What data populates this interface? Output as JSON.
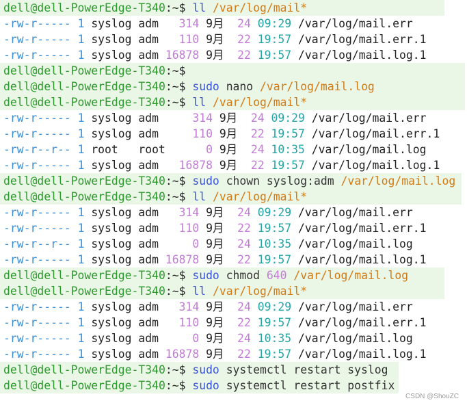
{
  "prompt": "dell@dell-PowerEdge-T340",
  "cwd": ":~$",
  "blocks": [
    {
      "type": "cmd",
      "w": "w650",
      "cmd": "ll",
      "args": "",
      "path": "/var/log/mail*"
    },
    {
      "type": "ls",
      "rows": [
        {
          "perm": "-rw-r-----",
          "links": "1",
          "owner": "syslog",
          "group": "adm",
          "size": "  314",
          "month": "9月",
          "day": "24",
          "time": "09:29",
          "file": "/var/log/mail.err"
        },
        {
          "perm": "-rw-r-----",
          "links": "1",
          "owner": "syslog",
          "group": "adm",
          "size": "  110",
          "month": "9月",
          "day": "22",
          "time": "19:57",
          "file": "/var/log/mail.err.1"
        },
        {
          "perm": "-rw-r-----",
          "links": "1",
          "owner": "syslog",
          "group": "adm",
          "size": "16878",
          "month": "9月",
          "day": "22",
          "time": "19:57",
          "file": "/var/log/mail.log.1"
        }
      ]
    },
    {
      "type": "cmd",
      "w": "w680",
      "cmd": "",
      "args": "",
      "path": ""
    },
    {
      "type": "cmd",
      "w": "w680",
      "cmd": "sudo",
      "args": "nano",
      "path": "/var/log/mail.log"
    },
    {
      "type": "cmd",
      "w": "w680",
      "cmd": "ll",
      "args": "",
      "path": "/var/log/mail*"
    },
    {
      "type": "ls",
      "rows": [
        {
          "perm": "-rw-r-----",
          "links": "1",
          "owner": "syslog",
          "group": "adm  ",
          "size": "  314",
          "month": "9月",
          "day": "24",
          "time": "09:29",
          "file": "/var/log/mail.err"
        },
        {
          "perm": "-rw-r-----",
          "links": "1",
          "owner": "syslog",
          "group": "adm  ",
          "size": "  110",
          "month": "9月",
          "day": "22",
          "time": "19:57",
          "file": "/var/log/mail.err.1"
        },
        {
          "perm": "-rw-r--r--",
          "links": "1",
          "owner": "root  ",
          "group": "root ",
          "size": "    0",
          "month": "9月",
          "day": "24",
          "time": "10:35",
          "file": "/var/log/mail.log"
        },
        {
          "perm": "-rw-r-----",
          "links": "1",
          "owner": "syslog",
          "group": "adm  ",
          "size": "16878",
          "month": "9月",
          "day": "22",
          "time": "19:57",
          "file": "/var/log/mail.log.1"
        }
      ]
    },
    {
      "type": "cmd",
      "w": "w675",
      "cmd": "sudo",
      "args": "chown syslog:adm",
      "path": "/var/log/mail.log"
    },
    {
      "type": "cmd",
      "w": "w675",
      "cmd": "ll",
      "args": "",
      "path": "/var/log/mail*"
    },
    {
      "type": "ls",
      "rows": [
        {
          "perm": "-rw-r-----",
          "links": "1",
          "owner": "syslog",
          "group": "adm",
          "size": "  314",
          "month": "9月",
          "day": "24",
          "time": "09:29",
          "file": "/var/log/mail.err"
        },
        {
          "perm": "-rw-r-----",
          "links": "1",
          "owner": "syslog",
          "group": "adm",
          "size": "  110",
          "month": "9月",
          "day": "22",
          "time": "19:57",
          "file": "/var/log/mail.err.1"
        },
        {
          "perm": "-rw-r--r--",
          "links": "1",
          "owner": "syslog",
          "group": "adm",
          "size": "    0",
          "month": "9月",
          "day": "24",
          "time": "10:35",
          "file": "/var/log/mail.log"
        },
        {
          "perm": "-rw-r-----",
          "links": "1",
          "owner": "syslog",
          "group": "adm",
          "size": "16878",
          "month": "9月",
          "day": "22",
          "time": "19:57",
          "file": "/var/log/mail.log.1"
        }
      ]
    },
    {
      "type": "cmd",
      "w": "w650",
      "cmd": "sudo",
      "args": "chmod",
      "num": "640",
      "path": "/var/log/mail.log"
    },
    {
      "type": "cmd",
      "w": "w650",
      "cmd": "ll",
      "args": "",
      "path": "/var/log/mail*"
    },
    {
      "type": "ls",
      "rows": [
        {
          "perm": "-rw-r-----",
          "links": "1",
          "owner": "syslog",
          "group": "adm",
          "size": "  314",
          "month": "9月",
          "day": "24",
          "time": "09:29",
          "file": "/var/log/mail.err"
        },
        {
          "perm": "-rw-r-----",
          "links": "1",
          "owner": "syslog",
          "group": "adm",
          "size": "  110",
          "month": "9月",
          "day": "22",
          "time": "19:57",
          "file": "/var/log/mail.err.1"
        },
        {
          "perm": "-rw-r-----",
          "links": "1",
          "owner": "syslog",
          "group": "adm",
          "size": "    0",
          "month": "9月",
          "day": "24",
          "time": "10:35",
          "file": "/var/log/mail.log"
        },
        {
          "perm": "-rw-r-----",
          "links": "1",
          "owner": "syslog",
          "group": "adm",
          "size": "16878",
          "month": "9月",
          "day": "22",
          "time": "19:57",
          "file": "/var/log/mail.log.1"
        }
      ]
    },
    {
      "type": "cmd",
      "w": "w583",
      "cmd": "sudo",
      "args": "systemctl restart syslog",
      "path": ""
    },
    {
      "type": "cmd",
      "w": "w583",
      "cmd": "sudo",
      "args": "systemctl restart postfix",
      "path": ""
    }
  ],
  "watermark": "CSDN @ShouZC"
}
